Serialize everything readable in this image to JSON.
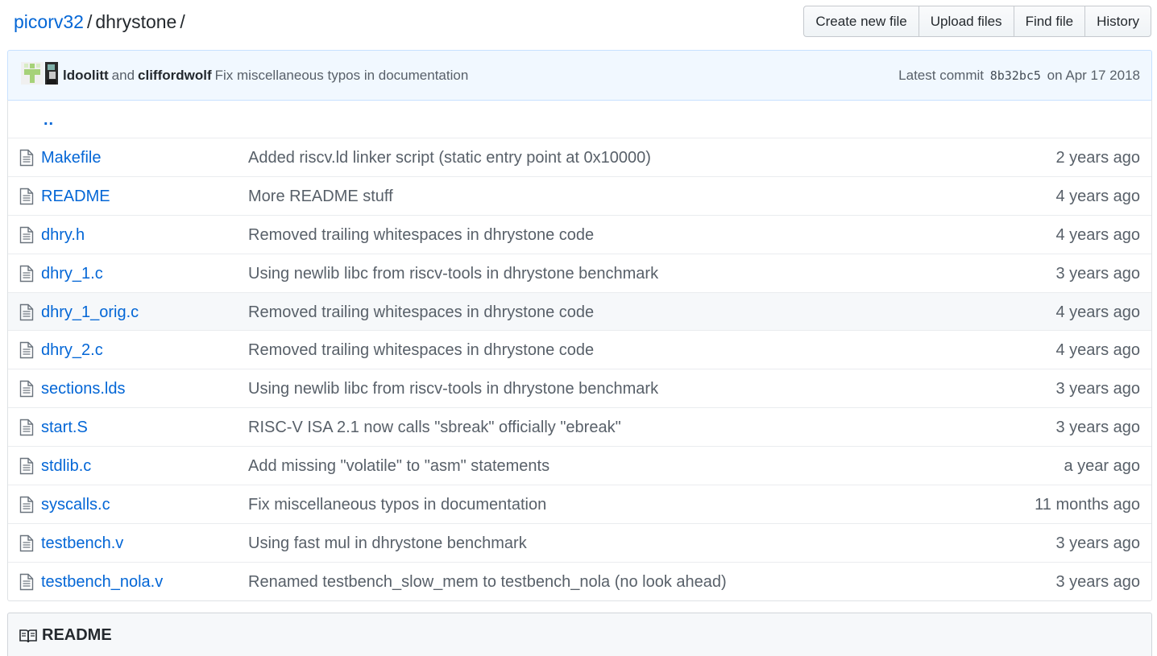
{
  "breadcrumb": {
    "repo": "picorv32",
    "separator": "/",
    "directory": "dhrystone",
    "trailing": "/"
  },
  "buttons": {
    "create": "Create new file",
    "upload": "Upload files",
    "find": "Find file",
    "history": "History"
  },
  "commit": {
    "author1": "ldoolitt",
    "and": "and",
    "author2": "cliffordwolf",
    "message": "Fix miscellaneous typos in documentation",
    "latest_label": "Latest commit",
    "sha": "8b32bc5",
    "date": "on Apr 17 2018"
  },
  "parent_dir": "..",
  "files": [
    {
      "name": "Makefile",
      "message": "Added riscv.ld linker script (static entry point at 0x10000)",
      "age": "2 years ago"
    },
    {
      "name": "README",
      "message": "More README stuff",
      "age": "4 years ago"
    },
    {
      "name": "dhry.h",
      "message": "Removed trailing whitespaces in dhrystone code",
      "age": "4 years ago"
    },
    {
      "name": "dhry_1.c",
      "message": "Using newlib libc from riscv-tools in dhrystone benchmark",
      "age": "3 years ago"
    },
    {
      "name": "dhry_1_orig.c",
      "message": "Removed trailing whitespaces in dhrystone code",
      "age": "4 years ago"
    },
    {
      "name": "dhry_2.c",
      "message": "Removed trailing whitespaces in dhrystone code",
      "age": "4 years ago"
    },
    {
      "name": "sections.lds",
      "message": "Using newlib libc from riscv-tools in dhrystone benchmark",
      "age": "3 years ago"
    },
    {
      "name": "start.S",
      "message": "RISC-V ISA 2.1 now calls \"sbreak\" officially \"ebreak\"",
      "age": "3 years ago"
    },
    {
      "name": "stdlib.c",
      "message": "Add missing \"volatile\" to \"asm\" statements",
      "age": "a year ago"
    },
    {
      "name": "syscalls.c",
      "message": "Fix miscellaneous typos in documentation",
      "age": "11 months ago"
    },
    {
      "name": "testbench.v",
      "message": "Using fast mul in dhrystone benchmark",
      "age": "3 years ago"
    },
    {
      "name": "testbench_nola.v",
      "message": "Renamed testbench_slow_mem to testbench_nola (no look ahead)",
      "age": "3 years ago"
    }
  ],
  "icons": {
    "file": "file-icon",
    "readme": "book-icon"
  },
  "readme": {
    "title": "README"
  },
  "colors": {
    "link": "#0366d6",
    "commit_bg": "#f1f8ff",
    "muted": "#586069"
  }
}
